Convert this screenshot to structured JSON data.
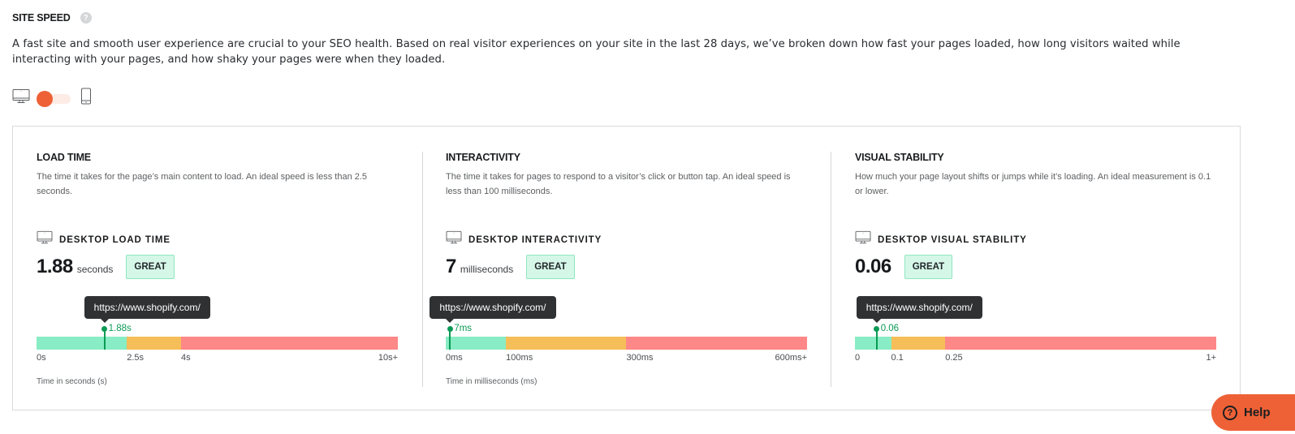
{
  "header": {
    "title": "SITE SPEED",
    "help_icon": "question-circle-icon",
    "intro": "A fast site and smooth user experience are crucial to your SEO health. Based on real visitor experiences on your site in the last 28 days, we’ve broken down how fast your pages loaded, how long visitors waited while interacting with your pages, and how shaky your pages were when they loaded."
  },
  "device_toggle": {
    "left_icon": "desktop-icon",
    "right_icon": "mobile-icon",
    "selected": "desktop"
  },
  "metrics": [
    {
      "title": "LOAD TIME",
      "description": "The time it takes for the page’s main content to load. An ideal speed is less than 2.5 seconds.",
      "metric_label": "DESKTOP LOAD TIME",
      "value": "1.88",
      "unit": "seconds",
      "badge": "GREAT",
      "tooltip": "https://www.shopify.com/",
      "marker_label": "1.88s",
      "marker_fraction": 0.188,
      "segments": [
        {
          "type": "good",
          "fraction": 0.25
        },
        {
          "type": "mid",
          "fraction": 0.15
        },
        {
          "type": "bad",
          "fraction": 0.6
        }
      ],
      "ticks": [
        {
          "label": "0s",
          "fraction": 0
        },
        {
          "label": "2.5s",
          "fraction": 0.25
        },
        {
          "label": "4s",
          "fraction": 0.4
        },
        {
          "label": "10s+",
          "fraction": 1
        }
      ],
      "axis_label": "Time in seconds (s)"
    },
    {
      "title": "INTERACTIVITY",
      "description": "The time it takes for pages to respond to a visitor’s click or button tap. An ideal speed is less than 100 milliseconds.",
      "metric_label": "DESKTOP INTERACTIVITY",
      "value": "7",
      "unit": "milliseconds",
      "badge": "GREAT",
      "tooltip": "https://www.shopify.com/",
      "marker_label": "7ms",
      "marker_fraction": 0.012,
      "segments": [
        {
          "type": "good",
          "fraction": 0.1667
        },
        {
          "type": "mid",
          "fraction": 0.3333
        },
        {
          "type": "bad",
          "fraction": 0.5
        }
      ],
      "ticks": [
        {
          "label": "0ms",
          "fraction": 0
        },
        {
          "label": "100ms",
          "fraction": 0.1667
        },
        {
          "label": "300ms",
          "fraction": 0.5
        },
        {
          "label": "600ms+",
          "fraction": 1
        }
      ],
      "axis_label": "Time in milliseconds (ms)"
    },
    {
      "title": "VISUAL STABILITY",
      "description": "How much your page layout shifts or jumps while it’s loading. An ideal measurement is 0.1 or lower.",
      "metric_label": "DESKTOP VISUAL STABILITY",
      "value": "0.06",
      "unit": "",
      "badge": "GREAT",
      "tooltip": "https://www.shopify.com/",
      "marker_label": "0.06",
      "marker_fraction": 0.06,
      "segments": [
        {
          "type": "good",
          "fraction": 0.1
        },
        {
          "type": "mid",
          "fraction": 0.15
        },
        {
          "type": "bad",
          "fraction": 0.75
        }
      ],
      "ticks": [
        {
          "label": "0",
          "fraction": 0
        },
        {
          "label": "0.1",
          "fraction": 0.1
        },
        {
          "label": "0.25",
          "fraction": 0.25
        },
        {
          "label": "1+",
          "fraction": 1
        }
      ],
      "axis_label": ""
    }
  ],
  "help_button": {
    "label": "Help",
    "icon": "question-circle-icon"
  }
}
